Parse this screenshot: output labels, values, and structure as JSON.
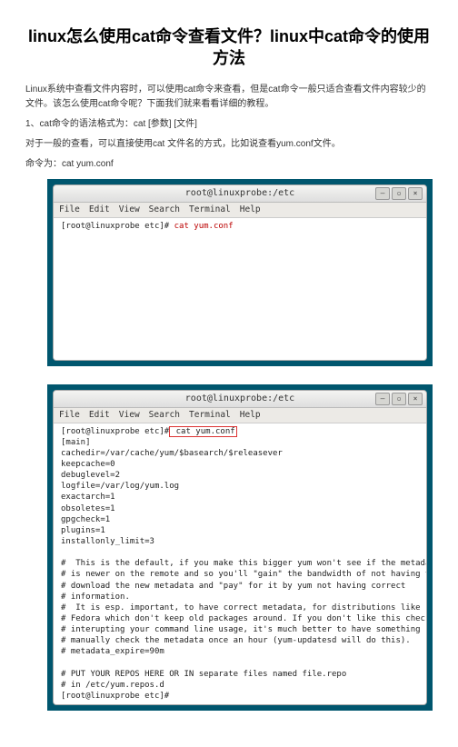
{
  "title": "linux怎么使用cat命令查看文件？linux中cat命令的使用方法",
  "p1": "Linux系统中查看文件内容时，可以使用cat命令来查看，但是cat命令一般只适合查看文件内容较少的文件。该怎么使用cat命令呢？下面我们就来看看详细的教程。",
  "p2": "1、cat命令的语法格式为：cat [参数] [文件]",
  "p3": "对于一般的查看，可以直接使用cat 文件名的方式，比如说查看yum.conf文件。",
  "p4": "命令为：cat yum.conf",
  "term1": {
    "title": "root@linuxprobe:/etc",
    "menus": [
      "File",
      "Edit",
      "View",
      "Search",
      "Terminal",
      "Help"
    ],
    "prompt": "[root@linuxprobe etc]# ",
    "cmd": "cat yum.conf"
  },
  "term2": {
    "title": "root@linuxprobe:/etc",
    "menus": [
      "File",
      "Edit",
      "View",
      "Search",
      "Terminal",
      "Help"
    ],
    "line_prompt": "[root@linuxprobe etc]#",
    "cmd": " cat yum.conf",
    "body": "[main]\ncachedir=/var/cache/yum/$basearch/$releasever\nkeepcache=0\ndebuglevel=2\nlogfile=/var/log/yum.log\nexactarch=1\nobsoletes=1\ngpgcheck=1\nplugins=1\ninstallonly_limit=3\n\n#  This is the default, if you make this bigger yum won't see if the metadata\n# is newer on the remote and so you'll \"gain\" the bandwidth of not having to\n# download the new metadata and \"pay\" for it by yum not having correct\n# information.\n#  It is esp. important, to have correct metadata, for distributions like\n# Fedora which don't keep old packages around. If you don't like this checking\n# interupting your command line usage, it's much better to have something\n# manually check the metadata once an hour (yum-updatesd will do this).\n# metadata_expire=90m\n\n# PUT YOUR REPOS HERE OR IN separate files named file.repo\n# in /etc/yum.repos.d\n[root@linuxprobe etc]# "
  },
  "winbtns": {
    "min": "–",
    "max": "▫",
    "close": "×"
  }
}
